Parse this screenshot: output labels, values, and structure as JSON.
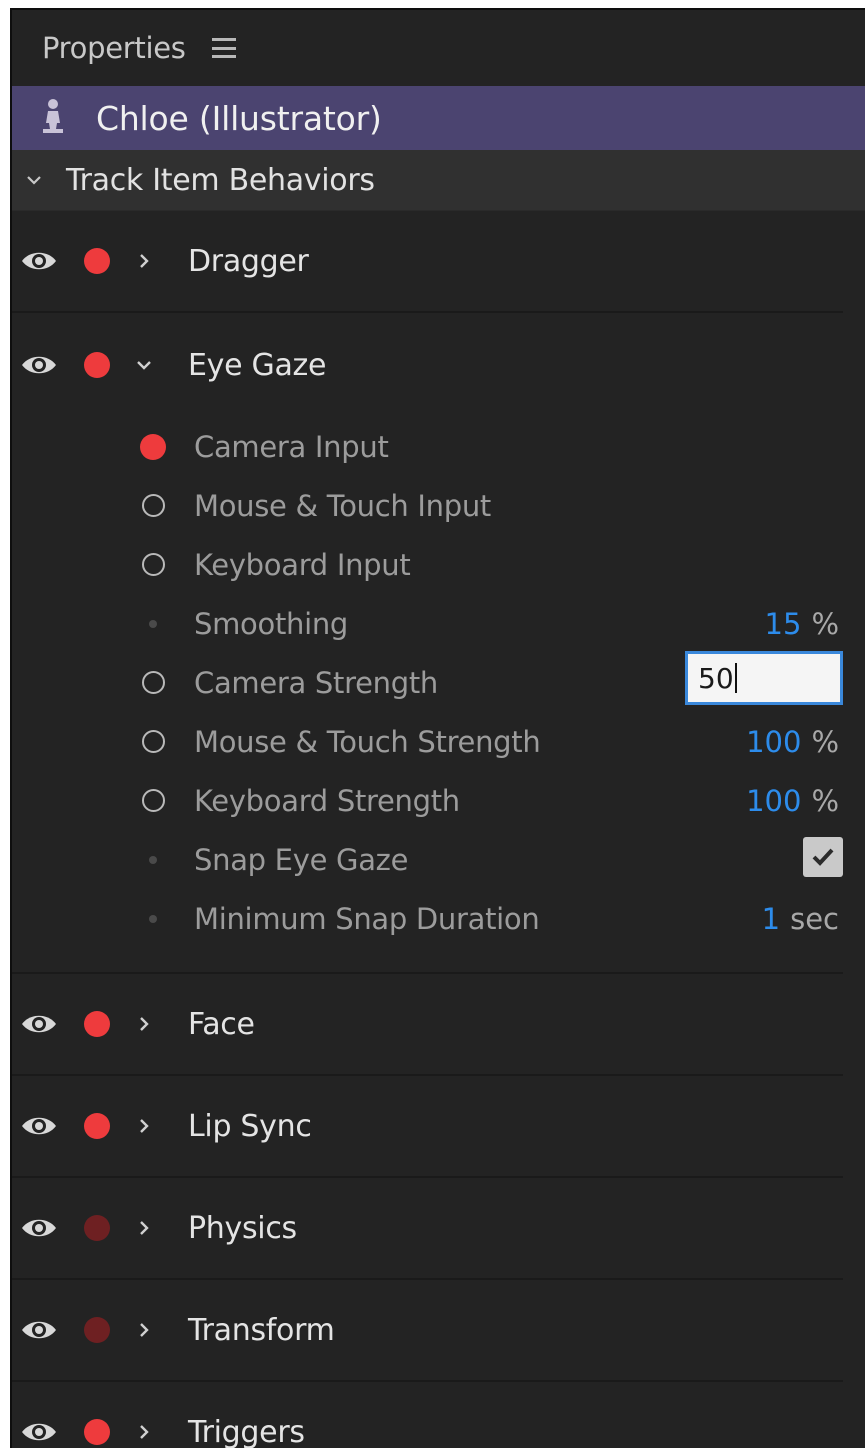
{
  "panel": {
    "title": "Properties",
    "menu_icon": "hamburger-menu-icon"
  },
  "puppet": {
    "name": "Chloe (Illustrator)",
    "icon": "puppet-icon",
    "bar_color": "#4b4470"
  },
  "section": {
    "label": "Track Item Behaviors",
    "expanded": true
  },
  "behaviors": [
    {
      "name": "Dragger",
      "expanded": false,
      "armed": true
    },
    {
      "name": "Eye Gaze",
      "expanded": true,
      "armed": true
    },
    {
      "name": "Face",
      "expanded": false,
      "armed": true
    },
    {
      "name": "Lip Sync",
      "expanded": false,
      "armed": true
    },
    {
      "name": "Physics",
      "expanded": false,
      "armed": false
    },
    {
      "name": "Transform",
      "expanded": false,
      "armed": false
    },
    {
      "name": "Triggers",
      "expanded": false,
      "armed": true
    }
  ],
  "eye_gaze": {
    "params": [
      {
        "label": "Camera Input",
        "indicator": "armed"
      },
      {
        "label": "Mouse & Touch Input",
        "indicator": "open"
      },
      {
        "label": "Keyboard Input",
        "indicator": "open"
      },
      {
        "label": "Smoothing",
        "indicator": "none",
        "value": "15",
        "unit": "%"
      },
      {
        "label": "Camera Strength",
        "indicator": "open",
        "input_value": "50"
      },
      {
        "label": "Mouse & Touch Strength",
        "indicator": "open",
        "value": "100",
        "unit": "%"
      },
      {
        "label": "Keyboard Strength",
        "indicator": "open",
        "value": "100",
        "unit": "%"
      },
      {
        "label": "Snap Eye Gaze",
        "indicator": "none",
        "checked": true
      },
      {
        "label": "Minimum Snap Duration",
        "indicator": "none",
        "value": "1",
        "unit": "sec"
      }
    ]
  },
  "colors": {
    "accent_blue": "#2d8ceb",
    "record_red": "#ee3b3d",
    "record_red_dim": "#6e2022",
    "panel_bg": "#232323"
  }
}
